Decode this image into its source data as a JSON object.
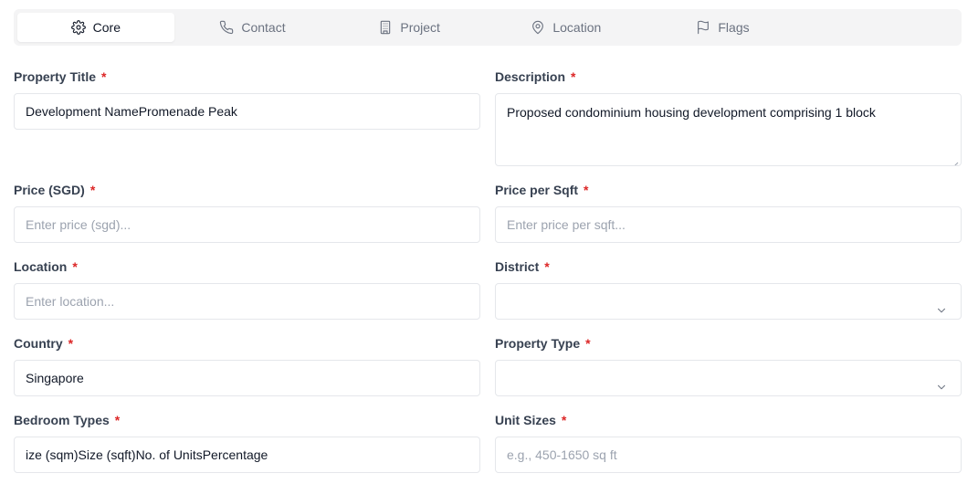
{
  "tabs": [
    {
      "label": "Core",
      "icon": "gear-icon",
      "active": true
    },
    {
      "label": "Contact",
      "icon": "phone-icon"
    },
    {
      "label": "Project",
      "icon": "building-icon"
    },
    {
      "label": "Location",
      "icon": "map-pin-icon"
    },
    {
      "label": "Flags",
      "icon": "flag-icon"
    }
  ],
  "required_marker": "*",
  "form": {
    "property_title": {
      "label": "Property Title",
      "value": "Development NamePromenade Peak"
    },
    "description": {
      "label": "Description",
      "value": "Proposed condominium housing development comprising 1 block"
    },
    "price": {
      "label": "Price (SGD)",
      "placeholder": "Enter price (sgd)..."
    },
    "price_per_sqft": {
      "label": "Price per Sqft",
      "placeholder": "Enter price per sqft..."
    },
    "location": {
      "label": "Location",
      "placeholder": "Enter location..."
    },
    "district": {
      "label": "District",
      "value": ""
    },
    "country": {
      "label": "Country",
      "value": "Singapore"
    },
    "property_type": {
      "label": "Property Type",
      "value": ""
    },
    "bedroom_types": {
      "label": "Bedroom Types",
      "value": "ize (sqm)Size (sqft)No. of UnitsPercentage"
    },
    "unit_sizes": {
      "label": "Unit Sizes",
      "placeholder": "e.g., 450-1650 sq ft"
    }
  },
  "colors": {
    "required": "#dc2626",
    "tab_bg": "#f4f4f5",
    "border": "#e5e7eb",
    "placeholder": "#9ca3af"
  }
}
